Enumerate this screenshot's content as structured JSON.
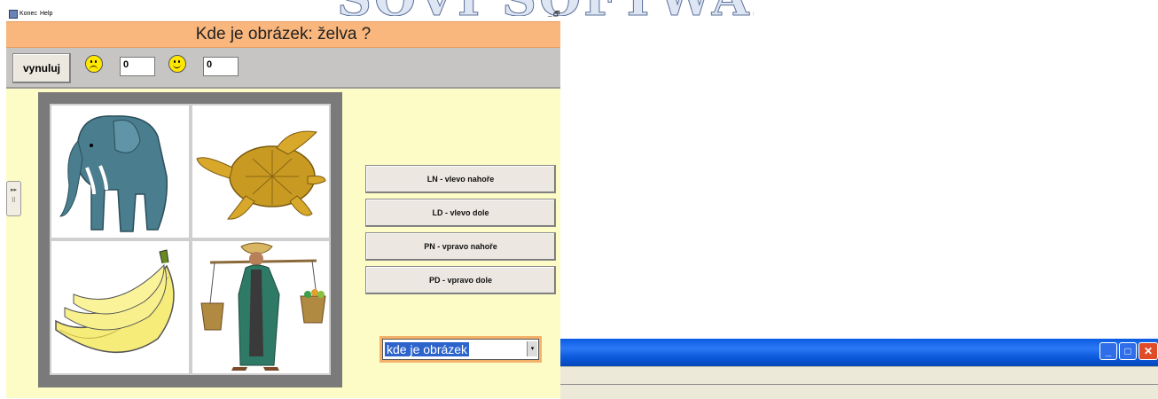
{
  "window": {
    "menu": [
      "Konec",
      "Help"
    ],
    "minimize": "_",
    "restore": "🗗"
  },
  "header": {
    "title": "Kde je obrázek: želva ?"
  },
  "toolbar": {
    "reset_label": "vynuluj",
    "score_wrong": "0",
    "score_right": "0",
    "icons": [
      "smiley-icon",
      "smiley-icon"
    ]
  },
  "images": {
    "top_left": "elephant",
    "top_right": "turtle",
    "bottom_left": "bananas",
    "bottom_right": "water-carrier"
  },
  "answers": [
    {
      "label": "LN - vlevo nahoře"
    },
    {
      "label": "LD - vlevo dole"
    },
    {
      "label": "PN - vpravo nahoře"
    },
    {
      "label": "PD - vpravo dole"
    }
  ],
  "mode_select": {
    "value": "kde je obrázek"
  },
  "taskbar": {
    "minimize": "_",
    "maximize": "□",
    "close": "✕",
    "colors": {
      "blue": "#0a5be2",
      "close": "#e04b2a"
    }
  },
  "colors": {
    "title_bg": "#f9b67d",
    "content_bg": "#fdfcc6",
    "toolbar_bg": "#c6c5c4"
  }
}
